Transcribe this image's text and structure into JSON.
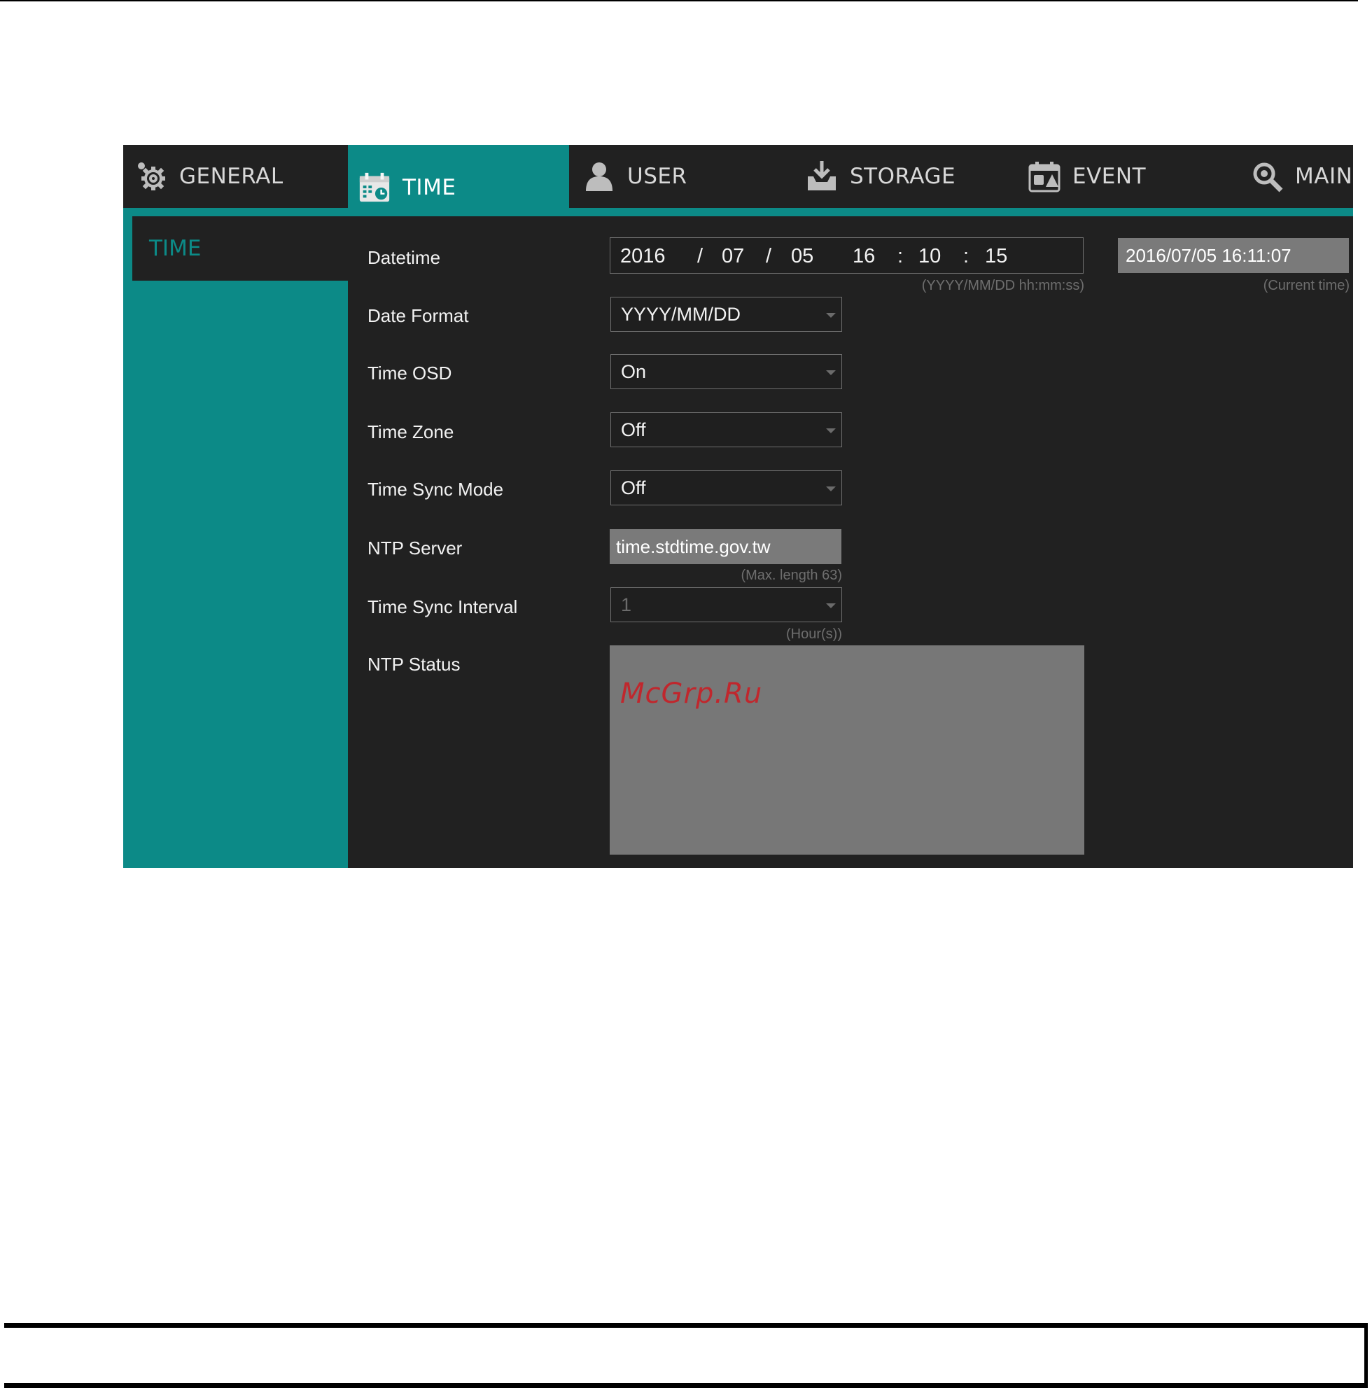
{
  "tabs": [
    {
      "label": "GENERAL",
      "icon": "gear-icon"
    },
    {
      "label": "TIME",
      "icon": "calendar-clock-icon"
    },
    {
      "label": "USER",
      "icon": "user-icon"
    },
    {
      "label": "STORAGE",
      "icon": "storage-icon"
    },
    {
      "label": "EVENT",
      "icon": "event-icon"
    },
    {
      "label": "MAIN",
      "icon": "maintenance-icon"
    }
  ],
  "active_tab": "TIME",
  "sidebar": {
    "items": [
      {
        "label": "TIME"
      }
    ]
  },
  "form": {
    "datetime": {
      "label": "Datetime",
      "year": "2016",
      "sep1": "/",
      "month": "07",
      "sep2": "/",
      "day": "05",
      "hour": "16",
      "sep3": ":",
      "minute": "10",
      "sep4": ":",
      "second": "15",
      "hint": "(YYYY/MM/DD hh:mm:ss)",
      "current_time": "2016/07/05 16:11:07",
      "current_hint": "(Current time)"
    },
    "date_format": {
      "label": "Date Format",
      "value": "YYYY/MM/DD"
    },
    "time_osd": {
      "label": "Time OSD",
      "value": "On"
    },
    "time_zone": {
      "label": "Time Zone",
      "value": "Off"
    },
    "time_sync_mode": {
      "label": "Time Sync Mode",
      "value": "Off"
    },
    "ntp_server": {
      "label": "NTP Server",
      "value": "time.stdtime.gov.tw",
      "hint": "(Max. length 63)"
    },
    "time_sync_interval": {
      "label": "Time Sync Interval",
      "value": "1",
      "hint": "(Hour(s))"
    },
    "ntp_status": {
      "label": "NTP Status"
    }
  },
  "watermark": "McGrp.Ru",
  "colors": {
    "accent": "#0c8a87",
    "panel": "#212121",
    "readonly_field": "#7a7a7a",
    "watermark": "#c0272d"
  }
}
